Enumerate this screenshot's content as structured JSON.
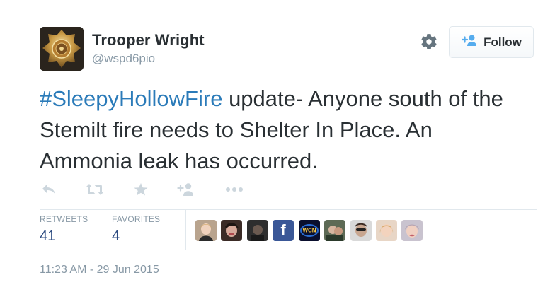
{
  "author": {
    "display_name": "Trooper Wright",
    "handle": "@wspd6pio"
  },
  "follow_button": {
    "label": "Follow"
  },
  "tweet": {
    "hashtag": "#SleepyHollowFire",
    "text": " update- Anyone south of the Stemilt fire needs to Shelter In Place. An Ammonia leak has occurred."
  },
  "actions": [
    {
      "icon": "reply-icon"
    },
    {
      "icon": "retweet-icon"
    },
    {
      "icon": "favorite-icon"
    },
    {
      "icon": "follow-user-icon"
    },
    {
      "icon": "more-icon"
    }
  ],
  "stats": {
    "retweets_label": "RETWEETS",
    "retweets_value": "41",
    "favorites_label": "FAVORITES",
    "favorites_value": "4"
  },
  "favoriters": [
    {
      "icon": "user-avatar"
    },
    {
      "icon": "user-avatar"
    },
    {
      "icon": "user-avatar"
    },
    {
      "icon": "facebook-icon",
      "text": "f"
    },
    {
      "icon": "wcn-logo",
      "text": "WCN"
    },
    {
      "icon": "user-avatar"
    },
    {
      "icon": "user-avatar"
    },
    {
      "icon": "user-avatar"
    },
    {
      "icon": "user-avatar"
    }
  ],
  "timestamp": "11:23 AM - 29 Jun 2015",
  "colors": {
    "hashtag": "#2b7bb9",
    "stat_value": "#2b4a80",
    "muted": "#8899a6",
    "facebook": "#3a5797"
  }
}
